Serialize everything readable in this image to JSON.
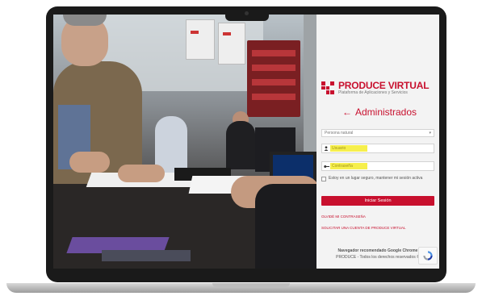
{
  "login": {
    "brand_title": "PRODUCE VIRTUAL",
    "brand_subtitle": "Plataforma de Aplicaciones y Servicios",
    "heading": "Administrados",
    "person_type_selected": "Persona natural",
    "user_placeholder": "Usuario",
    "password_placeholder": "Contraseña",
    "remember_text": "Estoy en un lugar seguro, mantener mi sesión activa",
    "login_button": "Iniciar Sesión",
    "forgot_link": "OLVIDÉ MI CONTRASEÑA",
    "request_link": "SOLICITAR UNA CUENTA DE PRODUCE VIRTUAL",
    "footer_browser": "Navegador recomendado Google Chrome",
    "footer_rights": "PRODUCE - Todos los derechos reservados ©"
  },
  "colors": {
    "brand_red": "#c8102e",
    "panel_bg": "#f3f3f3",
    "autofill_yellow": "#f6ef4c"
  },
  "icons": {
    "back": "left-arrow-icon",
    "user": "user-icon",
    "password": "key-icon",
    "recaptcha": "recaptcha-icon",
    "select": "chevron-down-icon"
  }
}
